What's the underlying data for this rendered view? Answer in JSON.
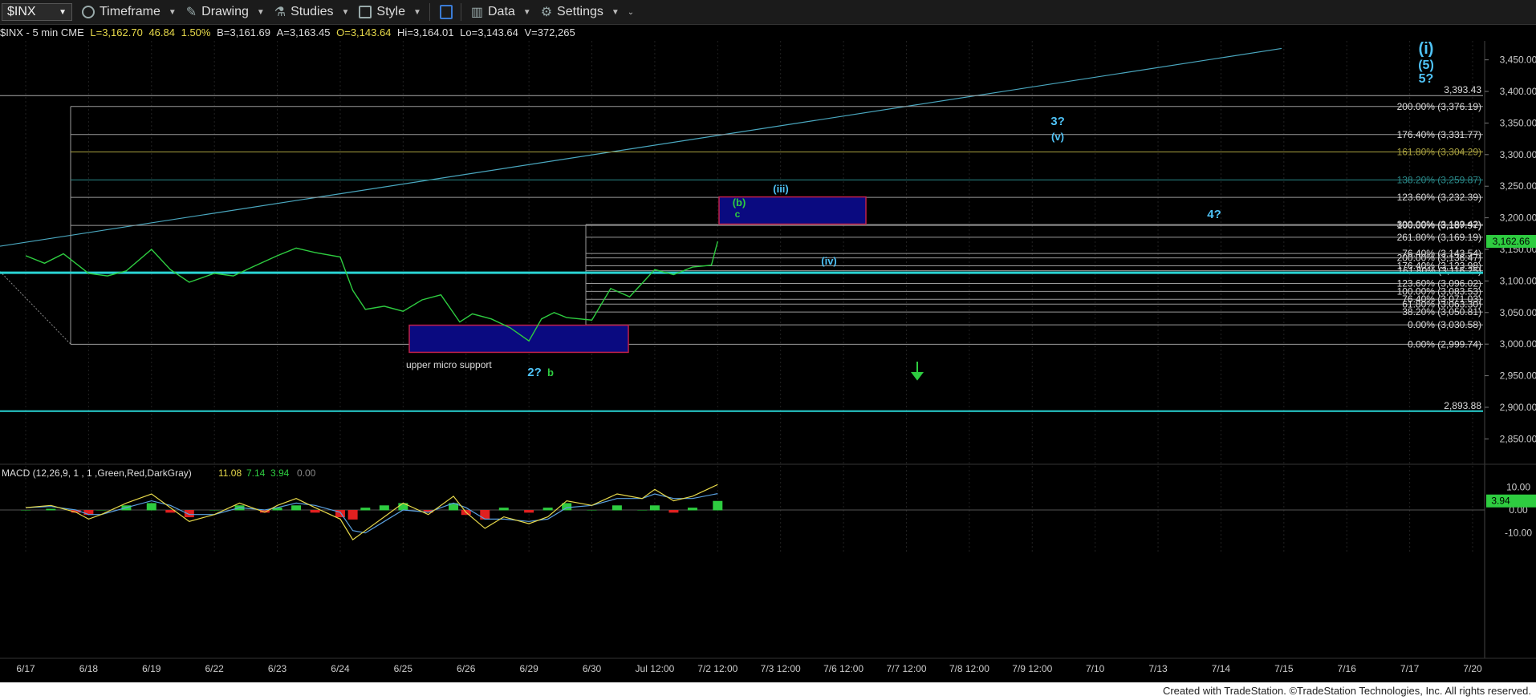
{
  "toolbar": {
    "symbol": "$INX",
    "items": [
      {
        "label": "Timeframe",
        "icon": "clock-icon"
      },
      {
        "label": "Drawing",
        "icon": "drawing-pen-icon"
      },
      {
        "label": "Studies",
        "icon": "flask-icon"
      },
      {
        "label": "Style",
        "icon": "style-icon"
      },
      {
        "label": "Data",
        "icon": "data-bars-icon"
      },
      {
        "label": "Settings",
        "icon": "gear-icon"
      }
    ]
  },
  "infobar": {
    "symbol_interval": "$INX - 5 min  CME",
    "last": "L=3,162.70",
    "change": "46.84",
    "change_pct": "1.50%",
    "bid": "B=3,161.69",
    "ask": "A=3,163.45",
    "open": "O=3,143.64",
    "high": "Hi=3,164.01",
    "low": "Lo=3,143.64",
    "volume": "V=372,265"
  },
  "colors": {
    "background": "#000000",
    "price": "#2ecc40",
    "cyan": "#29d3d3",
    "fib_line": "#9a9a9a",
    "box_fill": "#0a0a80",
    "box_border": "#c0204a",
    "label_blue": "#4fc3f7",
    "macd_up": "#2ecc40",
    "macd_down": "#e02020",
    "yellow": "#e6d84a"
  },
  "chart_data": {
    "type": "line",
    "title": "",
    "symbol": "$INX",
    "interval": "5 min",
    "ylim": [
      2820,
      3480
    ],
    "y_ticks": [
      "3,450.00",
      "3,400.00",
      "3,350.00",
      "3,300.00",
      "3,250.00",
      "3,200.00",
      "3,150.00",
      "3,100.00",
      "3,050.00",
      "3,000.00",
      "2,950.00",
      "2,900.00",
      "2,850.00"
    ],
    "y_tick_values": [
      3450,
      3400,
      3350,
      3300,
      3250,
      3200,
      3150,
      3100,
      3050,
      3000,
      2950,
      2900,
      2850
    ],
    "x_labels": [
      "6/17",
      "6/18",
      "6/19",
      "6/22",
      "6/23",
      "6/24",
      "6/25",
      "6/26",
      "6/29",
      "6/30",
      "Jul 12:00",
      "7/2 12:00",
      "7/3 12:00",
      "7/6 12:00",
      "7/7 12:00",
      "7/8 12:00",
      "7/9 12:00",
      "7/10",
      "7/13",
      "7/14",
      "7/15",
      "7/16",
      "7/17",
      "7/20"
    ],
    "last_price_label": "3,162.66",
    "price_series": {
      "name": "$INX",
      "x": [
        0,
        0.3,
        0.6,
        1.0,
        1.3,
        1.6,
        2.0,
        2.3,
        2.6,
        3.0,
        3.3,
        3.6,
        4.0,
        4.3,
        4.6,
        5.0,
        5.2,
        5.4,
        5.7,
        6.0,
        6.3,
        6.6,
        6.9,
        7.1,
        7.4,
        7.7,
        8.0,
        8.2,
        8.4,
        8.6,
        9.0,
        9.3,
        9.6,
        10.0,
        10.3,
        10.6,
        10.9,
        11.0
      ],
      "y": [
        3140,
        3128,
        3143,
        3112,
        3108,
        3116,
        3150,
        3118,
        3098,
        3112,
        3108,
        3122,
        3140,
        3152,
        3145,
        3138,
        3085,
        3055,
        3060,
        3052,
        3070,
        3078,
        3035,
        3048,
        3040,
        3026,
        3005,
        3040,
        3050,
        3042,
        3038,
        3088,
        3075,
        3118,
        3110,
        3122,
        3125,
        3162.7
      ]
    },
    "macd": {
      "label": "MACD (12,26,9, 1 , 1 ,Green,Red,DarkGray)",
      "macd_value": "11.08",
      "signal_value": "7.14",
      "hist_value": "3.94",
      "zero_value": "0.00",
      "ylim": [
        -14,
        14
      ],
      "y_ticks": [
        "10.00",
        "0.00",
        "-10.00"
      ],
      "y_tick_values": [
        10,
        0,
        -10
      ],
      "current_label": "3.94",
      "x": [
        0,
        0.4,
        0.8,
        1.0,
        1.2,
        1.6,
        2.0,
        2.3,
        2.6,
        3.0,
        3.4,
        3.8,
        4.0,
        4.3,
        4.6,
        5.0,
        5.2,
        5.4,
        5.7,
        6.0,
        6.4,
        6.8,
        7.0,
        7.3,
        7.6,
        8.0,
        8.3,
        8.6,
        9.0,
        9.4,
        9.8,
        10.0,
        10.3,
        10.6,
        11.0
      ],
      "macd_line": [
        1,
        2,
        -1,
        -4,
        -2,
        3,
        7,
        1,
        -5,
        -2,
        3,
        -1,
        2,
        5,
        1,
        -4,
        -13,
        -9,
        -3,
        3,
        -2,
        6,
        -1,
        -8,
        -3,
        -6,
        -3,
        4,
        2,
        7,
        5,
        9,
        4,
        6,
        11.08
      ],
      "signal_line": [
        1,
        1.5,
        0,
        -2,
        -2,
        1,
        4,
        2,
        -2,
        -2,
        1,
        0,
        1,
        3,
        2,
        -1,
        -9,
        -10,
        -5,
        0,
        -1,
        3,
        1,
        -4,
        -4,
        -5,
        -4,
        1,
        2,
        5,
        5,
        7,
        5,
        5,
        7.14
      ]
    }
  },
  "levels": {
    "left_group": [
      {
        "label": "200.00% (3,376.19)",
        "value": 3376.19
      },
      {
        "label": "176.40% (3,331.77)",
        "value": 3331.77
      },
      {
        "label": "161.80% (3,304.29)",
        "value": 3304.29
      },
      {
        "label": "138.20% (3,259.87)",
        "value": 3259.87
      },
      {
        "label": "123.60% (3,232.39)",
        "value": 3232.39
      },
      {
        "label": "100.00% (3,187.97)",
        "value": 3187.97
      },
      {
        "label": "0.00% (2,999.74)",
        "value": 2999.74
      }
    ],
    "right_group": [
      {
        "label": "300.00% (3,189.42)",
        "value": 3189.42
      },
      {
        "label": "261.80% (3,169.19)",
        "value": 3169.19
      },
      {
        "label": "76.40% (3,143.54)",
        "value": 3143.54
      },
      {
        "label": "200.00% (3,136.47)",
        "value": 3136.47
      },
      {
        "label": "176.40% (3,123.98)",
        "value": 3123.98
      },
      {
        "label": "161.80% (3,116.25)",
        "value": 3116.25
      },
      {
        "label": "123.60% (3,096.02)",
        "value": 3096.02
      },
      {
        "label": "100.00% (3,083.53)",
        "value": 3083.53
      },
      {
        "label": "76.40% (3,071.03)",
        "value": 3071.03
      },
      {
        "label": "61.80% (3,063.30)",
        "value": 3063.3
      },
      {
        "label": "38.20% (3,050.81)",
        "value": 3050.81
      },
      {
        "label": "0.00% (3,030.58)",
        "value": 3030.58
      }
    ],
    "top_line": {
      "label": "3,393.43",
      "value": 3393.43
    },
    "support_line": {
      "label": "2,893.88",
      "value": 2893.88
    },
    "cyan_horizontal": 3113
  },
  "annotations": {
    "wave_i": "(i)",
    "wave_5": "(5)",
    "wave_5q": "5?",
    "wave_3q": "3?",
    "wave_v": "(v)",
    "wave_iii": "(iii)",
    "wave_b_paren": "(b)",
    "wave_c": "c",
    "wave_4q": "4?",
    "wave_iv": "(iv)",
    "wave_2q": "2?",
    "wave_b": "b",
    "upper_micro_support": "upper micro support"
  },
  "footer": "Created with TradeStation. ©TradeStation Technologies, Inc. All rights reserved."
}
